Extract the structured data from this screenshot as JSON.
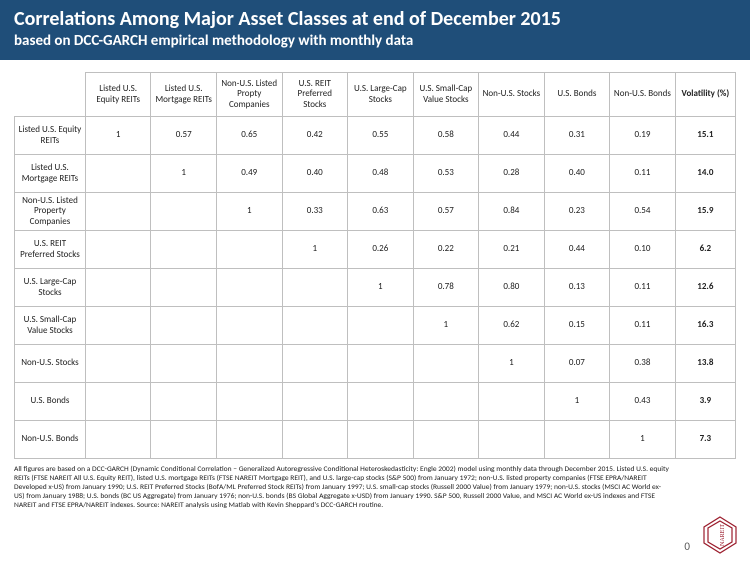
{
  "header": {
    "title": "Correlations Among Major Asset Classes at end of December 2015",
    "subtitle": "based on DCC-GARCH empirical methodology with monthly data"
  },
  "chart_data": {
    "type": "table",
    "title": "Correlations Among Major Asset Classes at end of December 2015",
    "columns": [
      "Listed U.S. Equity REITs",
      "Listed U.S. Mortgage REITs",
      "Non-U.S. Listed Propty Companies",
      "U.S. REIT Preferred Stocks",
      "U.S. Large-Cap Stocks",
      "U.S. Small-Cap Value Stocks",
      "Non-U.S. Stocks",
      "U.S. Bonds",
      "Non-U.S. Bonds",
      "Volatility (%)"
    ],
    "rows": [
      {
        "label": "Listed U.S. Equity REITs",
        "cells": [
          "1",
          "0.57",
          "0.65",
          "0.42",
          "0.55",
          "0.58",
          "0.44",
          "0.31",
          "0.19",
          "15.1"
        ]
      },
      {
        "label": "Listed U.S. Mortgage REITs",
        "cells": [
          "",
          "1",
          "0.49",
          "0.40",
          "0.48",
          "0.53",
          "0.28",
          "0.40",
          "0.11",
          "14.0"
        ]
      },
      {
        "label": "Non-U.S. Listed Property Companies",
        "cells": [
          "",
          "",
          "1",
          "0.33",
          "0.63",
          "0.57",
          "0.84",
          "0.23",
          "0.54",
          "15.9"
        ]
      },
      {
        "label": "U.S. REIT Preferred Stocks",
        "cells": [
          "",
          "",
          "",
          "1",
          "0.26",
          "0.22",
          "0.21",
          "0.44",
          "0.10",
          "6.2"
        ]
      },
      {
        "label": "U.S. Large-Cap Stocks",
        "cells": [
          "",
          "",
          "",
          "",
          "1",
          "0.78",
          "0.80",
          "0.13",
          "0.11",
          "12.6"
        ]
      },
      {
        "label": "U.S. Small-Cap Value Stocks",
        "cells": [
          "",
          "",
          "",
          "",
          "",
          "1",
          "0.62",
          "0.15",
          "0.11",
          "16.3"
        ]
      },
      {
        "label": "Non-U.S. Stocks",
        "cells": [
          "",
          "",
          "",
          "",
          "",
          "",
          "1",
          "0.07",
          "0.38",
          "13.8"
        ]
      },
      {
        "label": "U.S. Bonds",
        "cells": [
          "",
          "",
          "",
          "",
          "",
          "",
          "",
          "1",
          "0.43",
          "3.9"
        ]
      },
      {
        "label": "Non-U.S. Bonds",
        "cells": [
          "",
          "",
          "",
          "",
          "",
          "",
          "",
          "",
          "1",
          "7.3"
        ]
      }
    ]
  },
  "footnote": "All figures are based on a DCC-GARCH (Dynamic Conditional Correlation – Generalized Autoregressive Conditional Heteroskedasticity: Engle 2002) model using monthly data through December 2015. Listed U.S. equity REITs (FTSE NAREIT All U.S. Equity REIT), listed U.S. mortgage REITs (FTSE NAREIT Mortgage REIT), and U.S. large-cap stocks (S&P 500) from January 1972; non-U.S. listed property companies (FTSE EPRA/NAREIT Developed x-US) from January 1990; U.S. REIT Preferred Stocks (BofA/ML Preferred Stock REITs) from January 1997; U.S. small-cap stocks (Russell 2000 Value) from January 1979; non-U.S. stocks (MSCI AC World ex-US) from January 1988; U.S. bonds (BC US Aggregate) from January 1976; non-U.S. bonds (BS Global Aggregate x-USD) from January 1990. S&P 500, Russell 2000 Value, and MSCI AC World ex-US indexes and FTSE NAREIT and FTSE EPRA/NAREIT indexes. Source: NAREIT analysis using Matlab with Kevin Sheppard's DCC-GARCH routine.",
  "page_number": "0",
  "logo_text": "NAREIT"
}
